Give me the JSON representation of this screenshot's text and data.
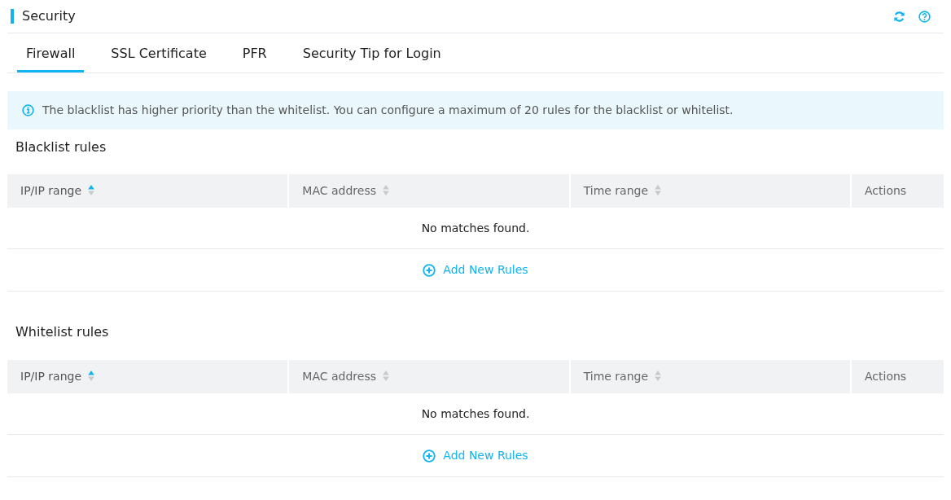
{
  "header": {
    "title": "Security"
  },
  "tabs": [
    {
      "label": "Firewall",
      "selected": true
    },
    {
      "label": "SSL Certificate",
      "selected": false
    },
    {
      "label": "PFR",
      "selected": false
    },
    {
      "label": "Security Tip for Login",
      "selected": false
    }
  ],
  "notice": "The blacklist has higher priority than the whitelist. You can configure a maximum of 20 rules for the blacklist or whitelist.",
  "sections": [
    {
      "title": "Blacklist rules",
      "columns": [
        {
          "label": "IP/IP range",
          "kind": "sortable",
          "sorted": true
        },
        {
          "label": "MAC address",
          "kind": "sortable",
          "sorted": false
        },
        {
          "label": "Time range",
          "kind": "sortable",
          "sorted": false
        },
        {
          "label": "Actions",
          "kind": "plain"
        }
      ],
      "empty_text": "No matches found.",
      "add_label": "Add New Rules"
    },
    {
      "title": "Whitelist rules",
      "columns": [
        {
          "label": "IP/IP range",
          "kind": "sortable",
          "sorted": true
        },
        {
          "label": "MAC address",
          "kind": "sortable",
          "sorted": false
        },
        {
          "label": "Time range",
          "kind": "sortable",
          "sorted": false
        },
        {
          "label": "Actions",
          "kind": "plain"
        }
      ],
      "empty_text": "No matches found.",
      "add_label": "Add New Rules"
    }
  ]
}
